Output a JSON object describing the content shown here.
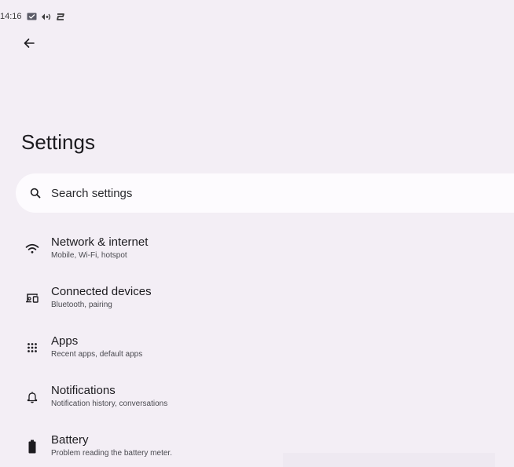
{
  "status_bar": {
    "time": "14:16",
    "icons": [
      "message-icon",
      "signal-icon",
      "sync-icon"
    ]
  },
  "header": {
    "back_icon": "arrow-back-icon",
    "title": "Settings"
  },
  "search": {
    "icon": "search-icon",
    "placeholder": "Search settings"
  },
  "settings": {
    "items": [
      {
        "icon": "wifi-icon",
        "title": "Network & internet",
        "subtitle": "Mobile, Wi-Fi, hotspot"
      },
      {
        "icon": "connected-devices-icon",
        "title": "Connected devices",
        "subtitle": "Bluetooth, pairing"
      },
      {
        "icon": "apps-grid-icon",
        "title": "Apps",
        "subtitle": "Recent apps, default apps"
      },
      {
        "icon": "bell-icon",
        "title": "Notifications",
        "subtitle": "Notification history, conversations"
      },
      {
        "icon": "battery-icon",
        "title": "Battery",
        "subtitle": "Problem reading the battery meter."
      }
    ]
  },
  "colors": {
    "background": "#f3eef5",
    "search_background": "#fdfbfe",
    "text_primary": "#1c1b1f",
    "text_secondary": "#4a4a50"
  }
}
